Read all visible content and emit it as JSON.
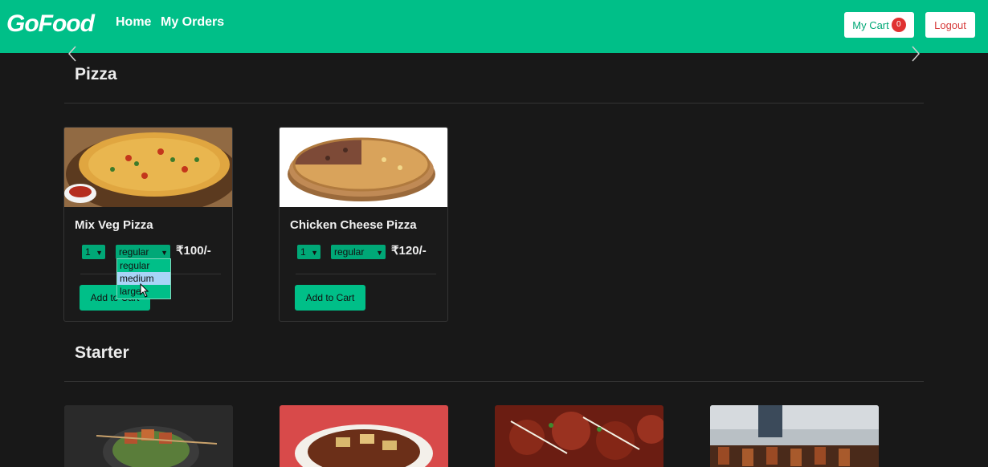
{
  "navbar": {
    "brand": "GoFood",
    "links": [
      "Home",
      "My Orders"
    ],
    "cart_label": "My Cart",
    "cart_count": "0",
    "logout_label": "Logout"
  },
  "sections": [
    {
      "title": "Pizza",
      "items": [
        {
          "name": "Mix Veg Pizza",
          "qty": "1",
          "size": "regular",
          "price": "₹100/-",
          "add_label": "Add to Cart"
        },
        {
          "name": "Chicken Cheese Pizza",
          "qty": "1",
          "size": "regular",
          "price": "₹120/-",
          "add_label": "Add to Cart"
        }
      ]
    },
    {
      "title": "Starter"
    }
  ],
  "size_dropdown": {
    "options": [
      "regular",
      "medium",
      "large"
    ],
    "highlighted": "medium"
  },
  "colors": {
    "accent": "#00bf88",
    "background": "#181818",
    "badge": "#e03131",
    "logout_text": "#d63a3a"
  }
}
